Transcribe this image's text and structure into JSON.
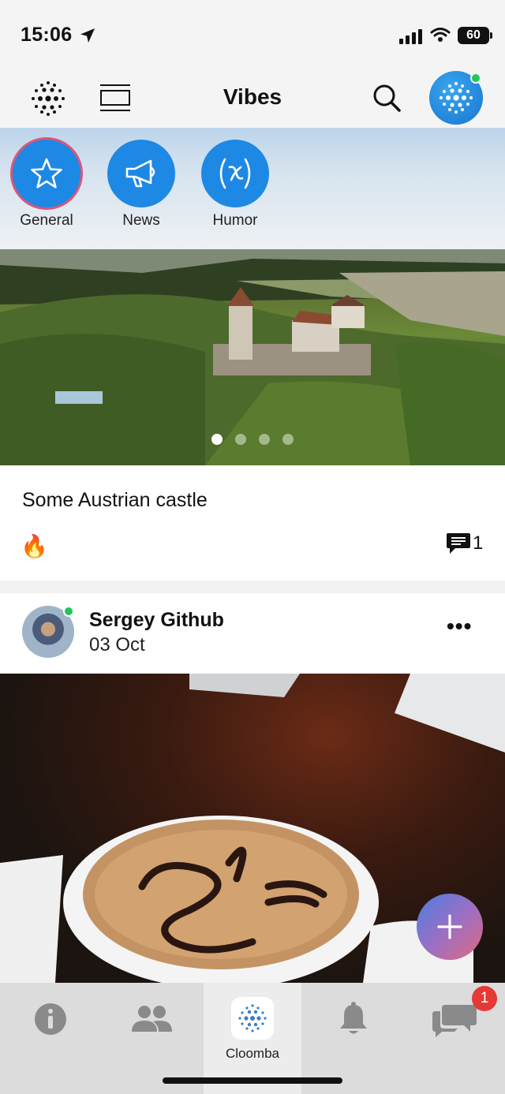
{
  "status_bar": {
    "time": "15:06",
    "battery": "60"
  },
  "header": {
    "title": "Vibes"
  },
  "categories": [
    {
      "label": "General",
      "icon": "star-icon",
      "selected": true
    },
    {
      "label": "News",
      "icon": "megaphone-icon",
      "selected": false
    },
    {
      "label": "Humor",
      "icon": "function-x-icon",
      "selected": false
    }
  ],
  "post1": {
    "carousel_total": 4,
    "carousel_current": 1,
    "text": "Some Austrian castle",
    "reaction": "🔥",
    "comment_count": "1"
  },
  "post2": {
    "author": "Sergey Github",
    "date": "03 Oct",
    "more_label": "•••"
  },
  "tabbar": {
    "items": [
      {
        "icon": "info-icon",
        "label": ""
      },
      {
        "icon": "people-icon",
        "label": ""
      },
      {
        "icon": "cloomba-logo-icon",
        "label": "Cloomba"
      },
      {
        "icon": "bell-icon",
        "label": ""
      },
      {
        "icon": "chat-icon",
        "label": ""
      }
    ],
    "chat_badge": "1"
  },
  "colors": {
    "accent": "#1e88e5",
    "online": "#22c55e",
    "badge": "#e53935"
  }
}
